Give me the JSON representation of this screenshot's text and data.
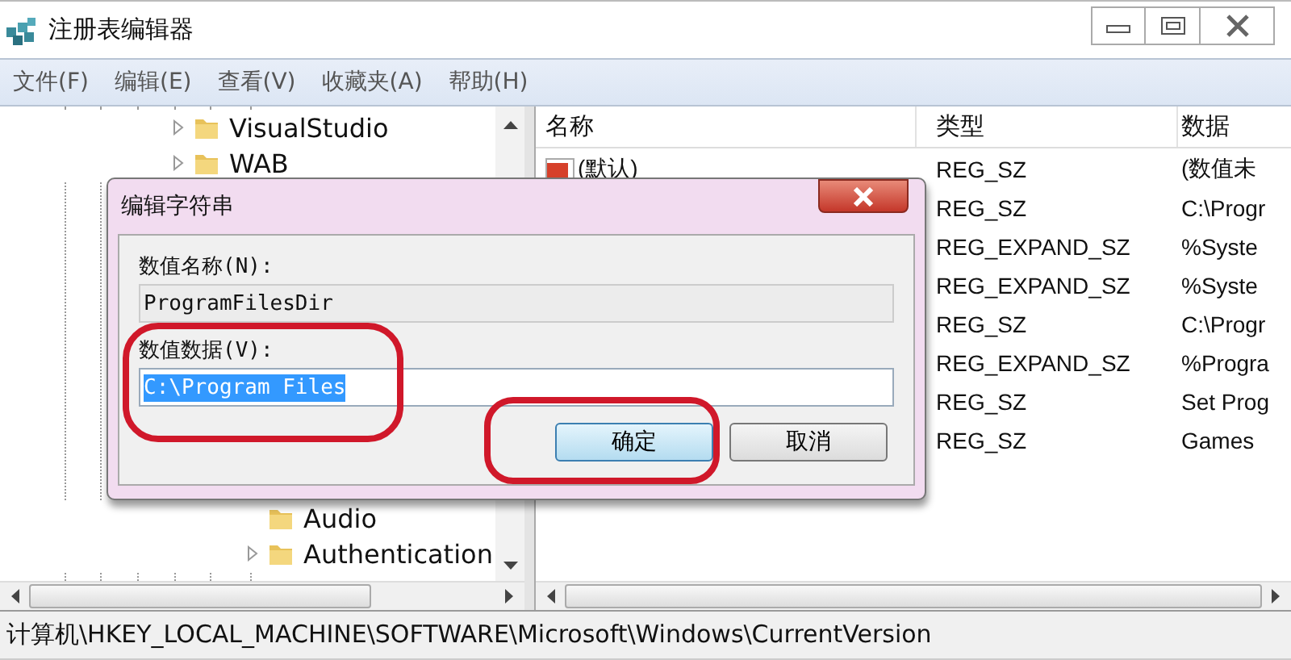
{
  "window": {
    "title": "注册表编辑器"
  },
  "menu": [
    "文件(F)",
    "编辑(E)",
    "查看(V)",
    "收藏夹(A)",
    "帮助(H)"
  ],
  "tree": {
    "items": [
      {
        "label": "VisualStudio",
        "expandable": true
      },
      {
        "label": "WAB",
        "expandable": true
      }
    ],
    "lower_items": [
      {
        "label": "Audio",
        "expandable": false
      },
      {
        "label": "Authentication",
        "expandable": true
      }
    ]
  },
  "list": {
    "columns": [
      "名称",
      "类型",
      "数据"
    ],
    "rows": [
      {
        "name": "(默认)",
        "type": "REG_SZ",
        "data": "(数值未"
      },
      {
        "type": "REG_SZ",
        "data": "C:\\Progr"
      },
      {
        "type": "REG_EXPAND_SZ",
        "data": "%Syste"
      },
      {
        "type": "REG_EXPAND_SZ",
        "data": "%Syste"
      },
      {
        "type": "REG_SZ",
        "data": "C:\\Progr"
      },
      {
        "type": "REG_EXPAND_SZ",
        "data": "%Progra"
      },
      {
        "type": "REG_SZ",
        "data": "Set Prog"
      },
      {
        "type": "REG_SZ",
        "data": "Games"
      }
    ]
  },
  "dialog": {
    "title": "编辑字符串",
    "fields": [
      {
        "label": "数值名称(N):",
        "value": "ProgramFilesDir",
        "editable": false,
        "selected": false,
        "highlighted": false
      },
      {
        "label": "数值数据(V):",
        "value": "C:\\Program Files",
        "editable": true,
        "selected": true,
        "highlighted": true
      }
    ],
    "buttons": [
      {
        "label": "确定",
        "default": true,
        "highlighted": true
      },
      {
        "label": "取消",
        "default": false,
        "highlighted": false
      }
    ]
  },
  "status_bar": "计算机\\HKEY_LOCAL_MACHINE\\SOFTWARE\\Microsoft\\Windows\\CurrentVersion"
}
